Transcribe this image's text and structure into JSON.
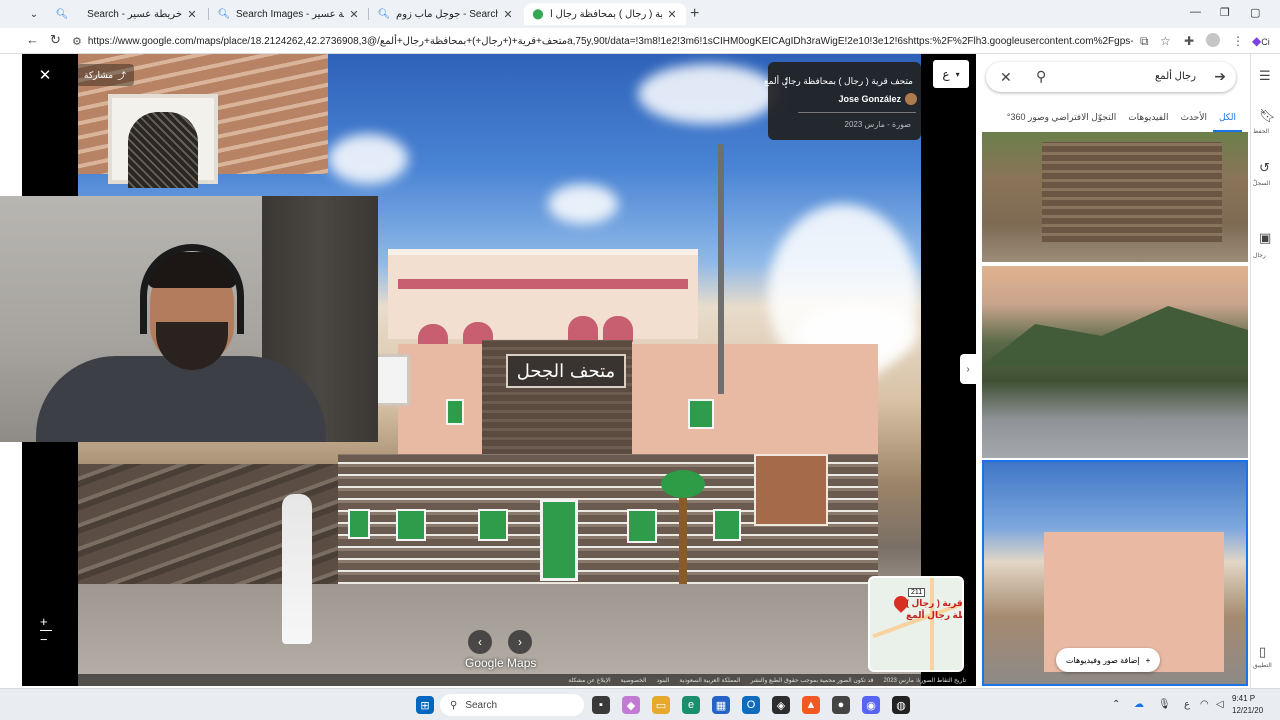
{
  "browser": {
    "tabs": [
      {
        "label": "Search - خريطة عسير",
        "icon": "search-icon",
        "active": false
      },
      {
        "label": "Search Images - خريطة عسير",
        "icon": "search-icon",
        "active": false
      },
      {
        "label": "جوجل ماب زوم - Search",
        "icon": "search-icon",
        "active": false
      },
      {
        "label": "متحف قرية ( رجال ) بمحافظة رجال أ...",
        "icon": "maps-pin-icon",
        "active": true
      }
    ],
    "url": "https://www.google.com/maps/place/متحف+قرية+(+رجال+)+بمحافظة+رجال+ألمع/@18.2124262,42.2736908,3a,75y,90t/data=!3m8!1e2!3m6!1sCIHM0ogKEICAgIDh3raWigE!2e10!3e12!6shttps:%2F%2Flh3.googleusercontent.com%2Fgps-cs-...",
    "profile_label": "Ci"
  },
  "viewer": {
    "share_label": "مشاركة",
    "card": {
      "title": "متحف قرية ( رجال ) بمحافظة رجال ألمع",
      "author": "Jose González",
      "date": "صورة - مارس 2023"
    },
    "panel_dropdown": "ع",
    "photo_sign": "متحف الجحل",
    "logo": "Google Maps",
    "footer": [
      "تاريخ التقاط الصورة: مارس 2023",
      "قد تكون الصور محمية بموجب حقوق الطبع والنشر",
      "المملكة العربية السعودية",
      "البنود",
      "الخصوصية",
      "الإبلاغ عن مشكلة"
    ],
    "minimap": {
      "place": "متحف قرية ( رجال )",
      "place_line2": "بمحافظة رجال ألمع",
      "route": "211"
    }
  },
  "side": {
    "search_value": "رجال ألمع",
    "tabs": [
      "الكل",
      "الأحدث",
      "الفيديوهات",
      "التجوّل الافتراضي وصور 360°"
    ],
    "active_tab": 0,
    "add_media_label": "إضافة صور وفيديوهات"
  },
  "rail": {
    "labels": [
      "الحفظ",
      "السجلّ",
      "رجال",
      "التطبيق"
    ]
  },
  "taskbar": {
    "search_label": "Search",
    "time": "9:41 P",
    "date": "12/21/20",
    "lang": "ع"
  }
}
